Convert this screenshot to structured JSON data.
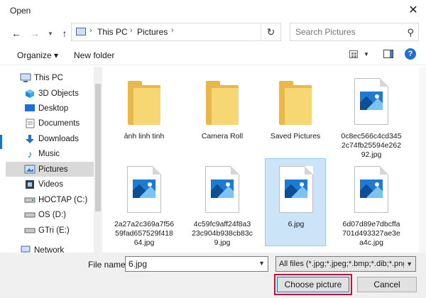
{
  "window": {
    "title": "Open"
  },
  "address": {
    "crumbs": [
      "This PC",
      "Pictures"
    ]
  },
  "search": {
    "placeholder": "Search Pictures"
  },
  "toolbar": {
    "organize": "Organize ▾",
    "new_folder": "New folder",
    "help": "?"
  },
  "nav": {
    "items": [
      {
        "label": "This PC",
        "icon": "pc-icon"
      },
      {
        "label": "3D Objects",
        "icon": "cube-icon"
      },
      {
        "label": "Desktop",
        "icon": "desktop-icon"
      },
      {
        "label": "Documents",
        "icon": "documents-icon"
      },
      {
        "label": "Downloads",
        "icon": "download-icon"
      },
      {
        "label": "Music",
        "icon": "music-icon"
      },
      {
        "label": "Pictures",
        "icon": "pictures-icon"
      },
      {
        "label": "Videos",
        "icon": "videos-icon"
      },
      {
        "label": "HOCTAP (C:)",
        "icon": "drive-icon"
      },
      {
        "label": "OS (D:)",
        "icon": "drive-icon"
      },
      {
        "label": "GTri (E:)",
        "icon": "drive-icon"
      },
      {
        "label": "Network",
        "icon": "network-icon"
      }
    ],
    "selected": "Pictures"
  },
  "files": [
    {
      "name": "ảnh linh tinh",
      "type": "folder"
    },
    {
      "name": "Camera Roll",
      "type": "folder"
    },
    {
      "name": "Saved Pictures",
      "type": "folder"
    },
    {
      "name": "0c8ec566c4cd3452c74fb25594e26292.jpg",
      "type": "image"
    },
    {
      "name": "2a27a2c369a7f5659fad657529f41864.jpg",
      "type": "image"
    },
    {
      "name": "4c59fc9aff24f8a323c904b938cb83c9.jpg",
      "type": "image"
    },
    {
      "name": "6.jpg",
      "type": "image",
      "selected": true
    },
    {
      "name": "6d07d89e7dbcffa701d493327ae3ea4c.jpg",
      "type": "image"
    }
  ],
  "footer": {
    "file_name_label": "File name:",
    "file_name_value": "6.jpg",
    "file_type": "All files (*.jpg;*.jpeg;*.bmp;*.dib;*.png",
    "choose_label": "Choose picture",
    "cancel_label": "Cancel"
  },
  "colors": {
    "accent": "#1e6fd0",
    "highlight": "#c8102e",
    "selection": "#cce4f7"
  }
}
